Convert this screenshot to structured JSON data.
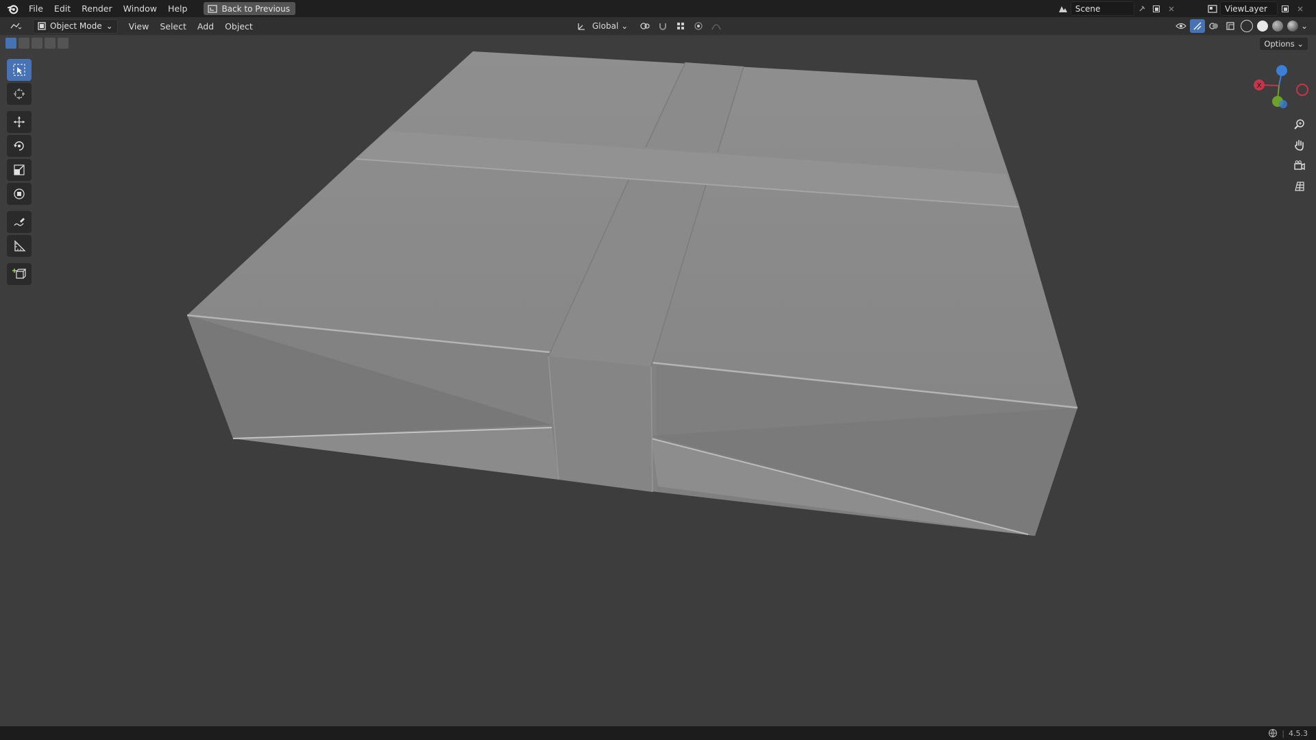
{
  "topbar": {
    "menus": [
      "File",
      "Edit",
      "Render",
      "Window",
      "Help"
    ],
    "back_label": "Back to Previous",
    "scene_label": "Scene",
    "viewlayer_label": "ViewLayer"
  },
  "header": {
    "mode_label": "Object Mode",
    "menus": [
      "View",
      "Select",
      "Add",
      "Object"
    ],
    "orientation_label": "Global"
  },
  "viewport": {
    "options_label": "Options",
    "gizmo": {
      "x_label": "X"
    }
  },
  "statusbar": {
    "version": "4.5.3"
  },
  "colors": {
    "background": "#3d3d3d",
    "topbar": "#1f1f1f",
    "header": "#303030",
    "accent": "#4772b3",
    "axis_x": "#c8344a",
    "axis_y": "#6ea12a",
    "axis_z": "#3b7fd6"
  }
}
